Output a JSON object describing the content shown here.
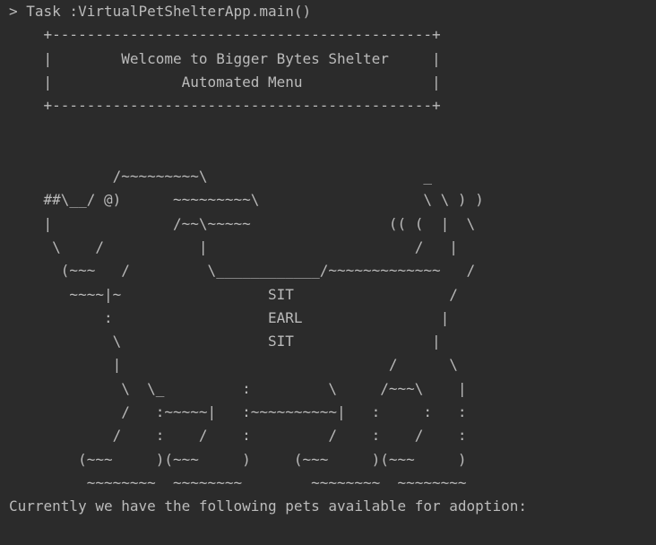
{
  "console": {
    "task_line": "> Task :VirtualPetShelterApp.main()",
    "header_box": [
      "    +--------------------------------------------+",
      "    |        Welcome to Bigger Bytes Shelter     |",
      "    |               Automated Menu               |",
      "    +--------------------------------------------+"
    ],
    "art_lines": [
      "",
      "",
      "            /~~~~~~~~~\\                         _",
      "    ##\\__/ @)      ~~~~~~~~~\\                   \\ \\ ) )",
      "    |              /~~\\~~~~~                (( (  |  \\",
      "     \\    /           |                        /   |",
      "      (~~~   /         \\____________/~~~~~~~~~~~~~   /",
      "       ~~~~|~                 SIT                  /",
      "           :                  EARL                |",
      "            \\                 SIT                |",
      "            |                               /      \\",
      "             \\  \\_         :         \\     /~~~\\    |",
      "             /   :~~~~~|   :~~~~~~~~~~|   :     :   :",
      "            /    :    /    :         /    :    /    :",
      "        (~~~     )(~~~     )     (~~~     )(~~~     )",
      "         ~~~~~~~~  ~~~~~~~~        ~~~~~~~~  ~~~~~~~~"
    ],
    "adoption_line": "Currently we have the following pets available for adoption:"
  },
  "colors": {
    "background": "#2b2b2b",
    "text": "#bbbbbb"
  }
}
